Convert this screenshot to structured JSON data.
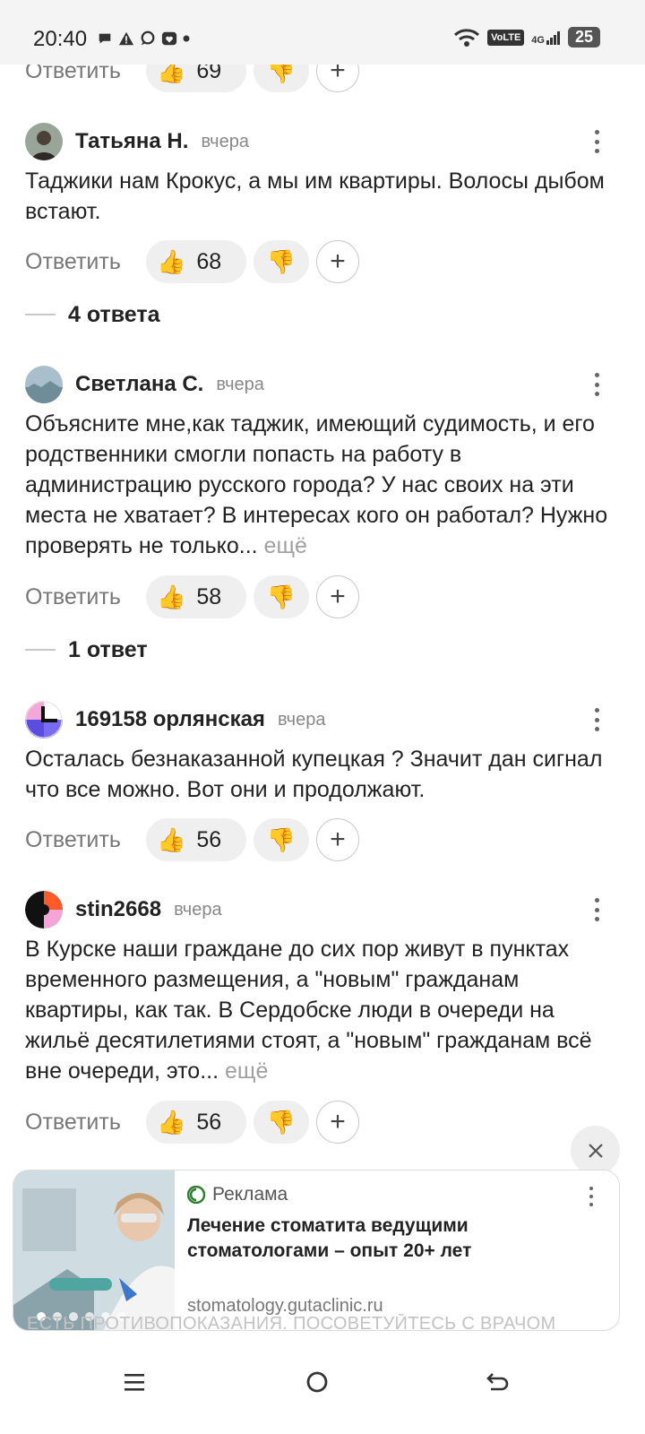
{
  "status_bar": {
    "time": "20:40",
    "volte": "VoLTE",
    "network": "4G",
    "battery": "25"
  },
  "actions": {
    "reply_label": "Ответить"
  },
  "top_partial": {
    "likes": "69"
  },
  "comments": [
    {
      "author": "Татьяна Н.",
      "time": "вчера",
      "text": "Таджики нам Крокус, а мы им квартиры. Волосы дыбом встают.",
      "more": "",
      "likes": "68",
      "replies": "4 ответа"
    },
    {
      "author": "Светлана С.",
      "time": "вчера",
      "text": "Объясните мне,как таджик, имеющий судимость, и его родственники смогли попасть на работу в администрацию русского города? У нас своих на эти места не хватает? В интересах кого он работал? Нужно проверять не только...",
      "more": "ещё",
      "likes": "58",
      "replies": "1 ответ"
    },
    {
      "author": "169158 орлянская",
      "time": "вчера",
      "text": "Осталась безнаказанной купецкая ? Значит дан сигнал что все можно. Вот они и продолжают.",
      "more": "",
      "likes": "56",
      "replies": ""
    },
    {
      "author": "stin2668",
      "time": "вчера",
      "text": "В Курске наши граждане до сих пор живут в пунктах временного размещения, а \"новым\" гражданам квартиры, как так. В Сердобске люди в очереди на жильё десятилетиями стоят, а \"новым\" гражданам всё вне очереди, это...",
      "more": "ещё",
      "likes": "56",
      "replies": ""
    }
  ],
  "ad": {
    "label": "Реклама",
    "title": "Лечение стоматита ведущими стоматологами – опыт 20+ лет",
    "domain": "stomatology.gutaclinic.ru",
    "disclaimer": "ЕСТЬ ПРОТИВОПОКАЗАНИЯ. ПОСОВЕТУЙТЕСЬ С ВРАЧОМ",
    "slides_total": 6,
    "slide_active": 1
  }
}
